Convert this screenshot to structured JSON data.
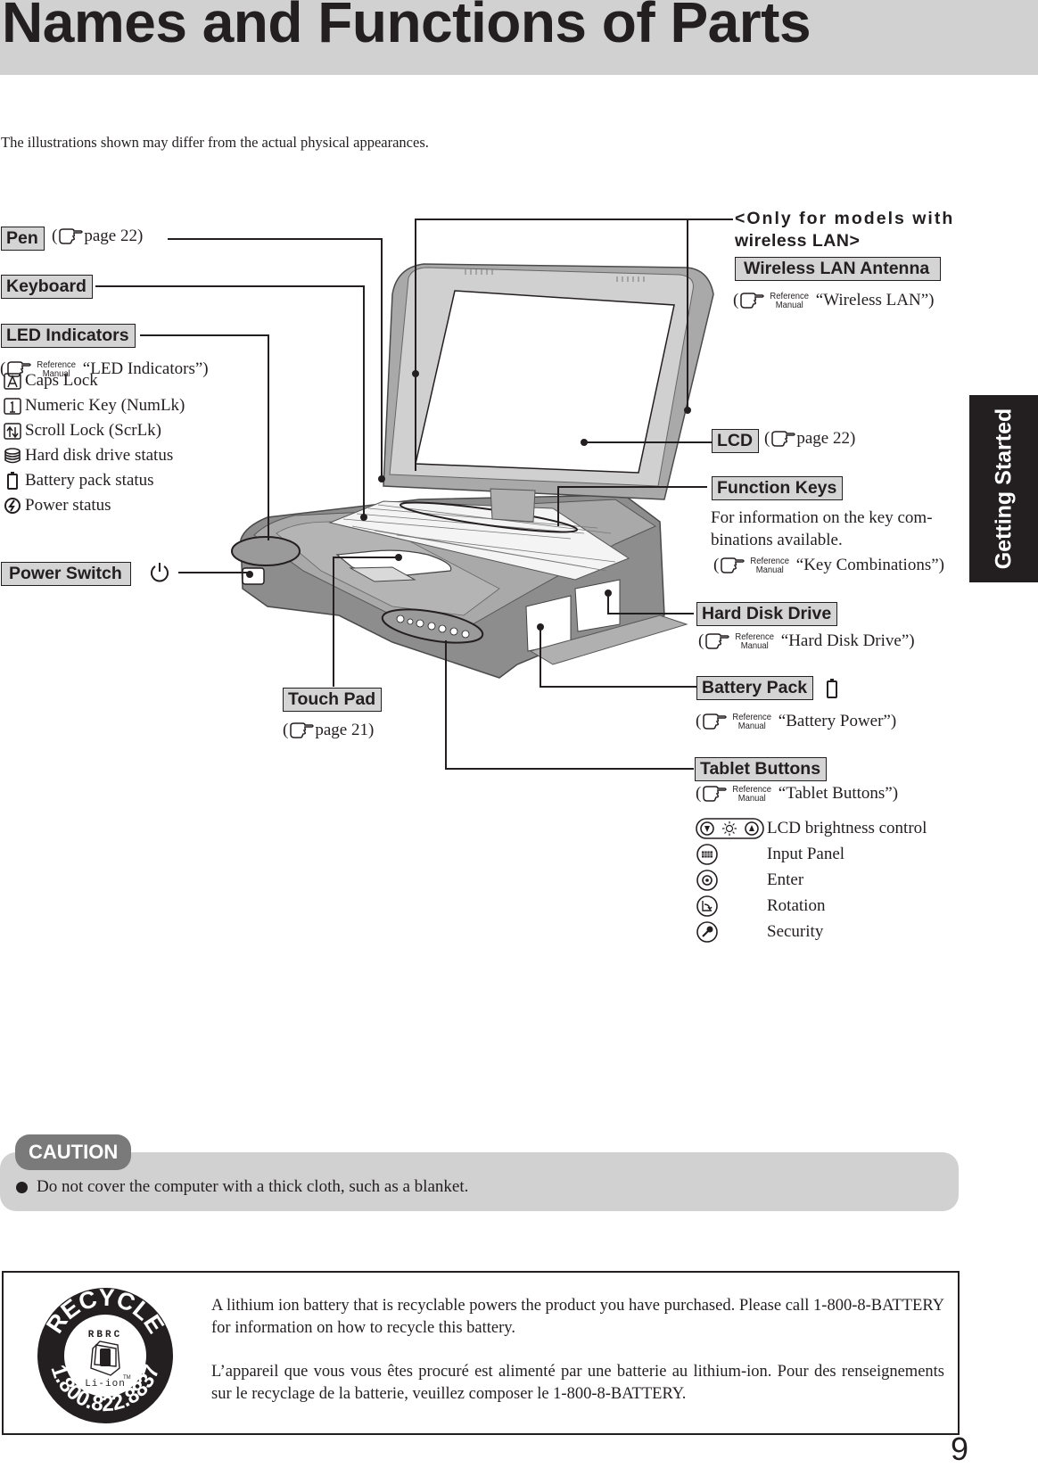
{
  "header": {
    "title": "Names and Functions of Parts",
    "intro": "The illustrations shown may differ from the actual physical appearances."
  },
  "side_tab": {
    "label": "Getting Started"
  },
  "reference_manual": {
    "line1": "Reference",
    "line2": "Manual"
  },
  "parts": {
    "pen": {
      "label": "Pen",
      "ref_open": "(",
      "ref_text": "page 22)"
    },
    "keyboard": {
      "label": "Keyboard"
    },
    "led_indicators": {
      "label": "LED Indicators",
      "ref_open": "(",
      "ref_text": "“LED Indicators”)",
      "items": [
        {
          "icon": "caps-lock-icon",
          "text": "Caps Lock"
        },
        {
          "icon": "numlock-icon",
          "text": "Numeric Key (NumLk)"
        },
        {
          "icon": "scroll-lock-icon",
          "text": "Scroll Lock (ScrLk)"
        },
        {
          "icon": "hard-disk-icon",
          "text": "Hard disk drive status"
        },
        {
          "icon": "battery-icon",
          "text": "Battery pack status"
        },
        {
          "icon": "power-status-icon",
          "text": "Power status"
        }
      ]
    },
    "power_switch": {
      "label": "Power Switch"
    },
    "wireless": {
      "note_line1": "<Only for models with",
      "note_line2": "wireless LAN>",
      "label": "Wireless LAN Antenna",
      "ref_open": "(",
      "ref_text": "“Wireless LAN”)"
    },
    "lcd": {
      "label": "LCD",
      "ref_open": "(",
      "ref_text": "page 22)"
    },
    "function_keys": {
      "label": "Function Keys",
      "desc_line1": "For information on the key com-",
      "desc_line2": "binations available.",
      "ref_open": "(",
      "ref_text": "“Key Combinations”)"
    },
    "hard_disk_drive": {
      "label": "Hard Disk Drive",
      "ref_open": "(",
      "ref_text": "“Hard Disk Drive”)"
    },
    "battery_pack": {
      "label": "Battery Pack",
      "ref_open": "(",
      "ref_text": "“Battery Power”)"
    },
    "touch_pad": {
      "label": "Touch Pad",
      "ref_open": "(",
      "ref_text": "page 21)"
    },
    "tablet_buttons": {
      "label": "Tablet Buttons",
      "ref_open": "(",
      "ref_text": "“Tablet Buttons”)",
      "items": [
        {
          "icon": "brightness-control-icon",
          "text": "LCD brightness control"
        },
        {
          "icon": "input-panel-icon",
          "text": "Input Panel"
        },
        {
          "icon": "enter-icon",
          "text": "Enter"
        },
        {
          "icon": "rotation-icon",
          "text": "Rotation"
        },
        {
          "icon": "security-icon",
          "text": "Security"
        }
      ]
    }
  },
  "caution": {
    "badge": "CAUTION",
    "items": [
      "Do not cover the computer with a thick cloth, such as a blanket."
    ]
  },
  "recycle": {
    "logo": {
      "top": "RECYCLE",
      "org": "RBRC",
      "chem": "Li-ion",
      "tm": "TM",
      "phone": "1.800.822.8837"
    },
    "text_en": "A lithium ion battery that is recyclable powers the product you have purchased.  Please call 1-800-8-BATTERY for information on how to recycle this battery.",
    "text_fr": "L’appareil que vous vous êtes procuré est alimenté par une batterie au lithium-ion. Pour des renseignements sur le recyclage de la batterie, veuillez composer le 1-800-8-BATTERY."
  },
  "footer": {
    "page_number": "9"
  }
}
